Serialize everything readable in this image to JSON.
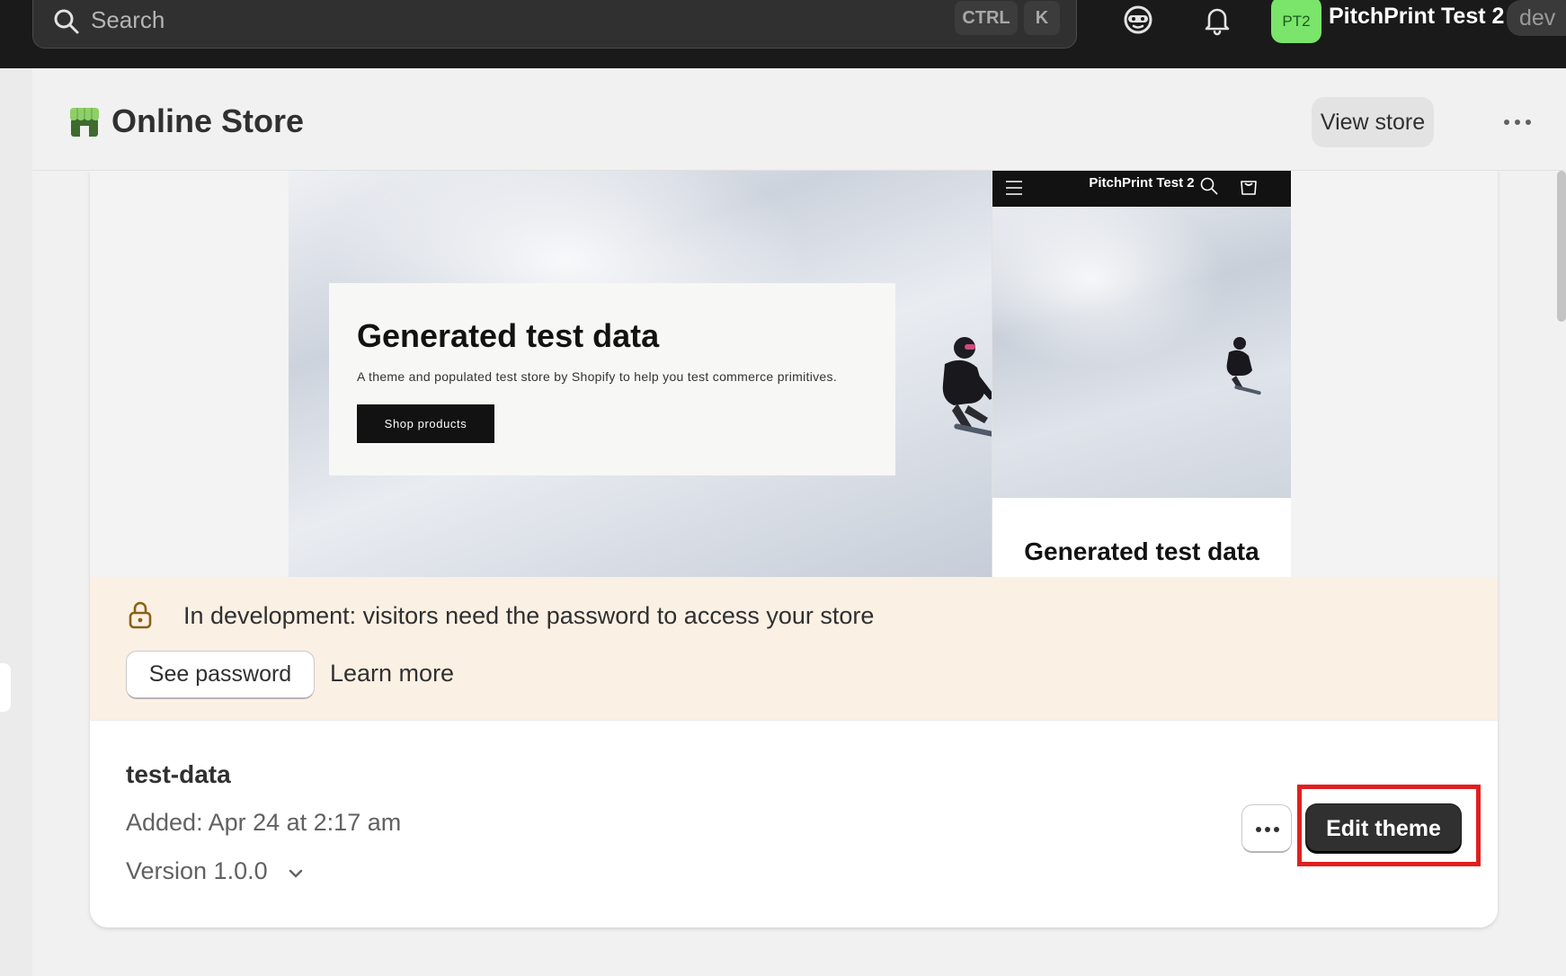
{
  "topbar": {
    "search_placeholder": "Search",
    "shortcut_ctrl": "CTRL",
    "shortcut_k": "K",
    "avatar_initials": "PT2",
    "store_name": "PitchPrint Test 2",
    "env_badge": "dev",
    "avatar_color": "#7ae56a"
  },
  "header": {
    "title": "Online Store",
    "view_store_label": "View store"
  },
  "preview": {
    "hero_title": "Generated test data",
    "hero_subtitle": "A theme and populated test store by Shopify to help you test commerce primitives.",
    "hero_button": "Shop products",
    "mobile_store_name": "PitchPrint Test 2",
    "mobile_heading": "Generated test data"
  },
  "banner": {
    "message": "In development: visitors need the password to access your store",
    "see_password_label": "See password",
    "learn_more_label": "Learn more",
    "background": "#fbf0e4"
  },
  "theme": {
    "name": "test-data",
    "added": "Added: Apr 24 at 2:17 am",
    "version": "Version 1.0.0",
    "edit_label": "Edit theme"
  },
  "accent": {
    "highlight": "#e01f1f",
    "primary_button": "#303030"
  }
}
